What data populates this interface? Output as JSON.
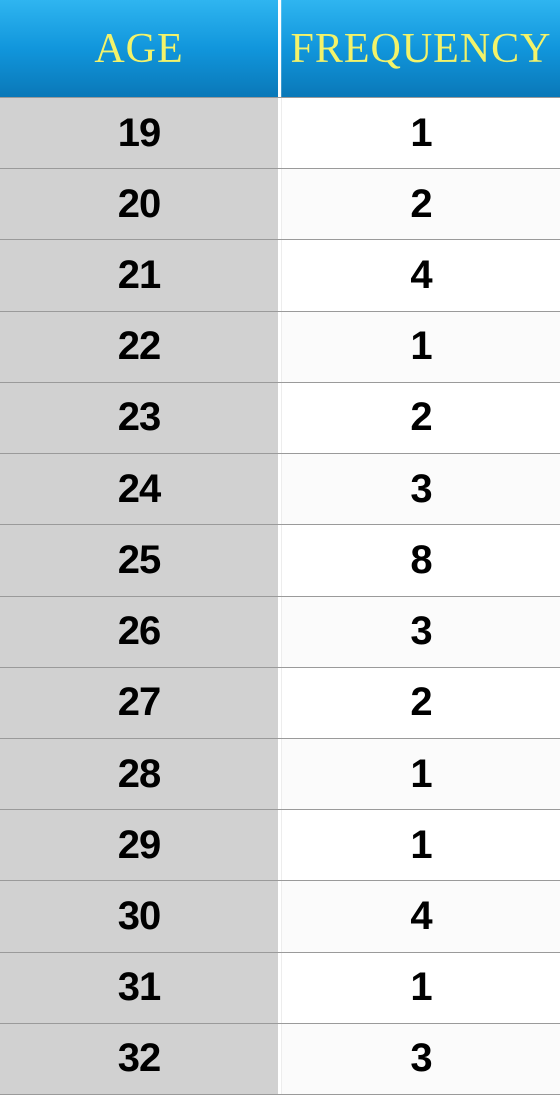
{
  "headers": {
    "age": "AGE",
    "freq": "FREQUENCY"
  },
  "rows": [
    {
      "age": "19",
      "freq": "1"
    },
    {
      "age": "20",
      "freq": "2"
    },
    {
      "age": "21",
      "freq": "4"
    },
    {
      "age": "22",
      "freq": "1"
    },
    {
      "age": "23",
      "freq": "2"
    },
    {
      "age": "24",
      "freq": "3"
    },
    {
      "age": "25",
      "freq": "8"
    },
    {
      "age": "26",
      "freq": "3"
    },
    {
      "age": "27",
      "freq": "2"
    },
    {
      "age": "28",
      "freq": "1"
    },
    {
      "age": "29",
      "freq": "1"
    },
    {
      "age": "30",
      "freq": "4"
    },
    {
      "age": "31",
      "freq": "1"
    },
    {
      "age": "32",
      "freq": "3"
    }
  ],
  "chart_data": {
    "type": "table",
    "title": "",
    "columns": [
      "AGE",
      "FREQUENCY"
    ],
    "categories": [
      19,
      20,
      21,
      22,
      23,
      24,
      25,
      26,
      27,
      28,
      29,
      30,
      31,
      32
    ],
    "values": [
      1,
      2,
      4,
      1,
      2,
      3,
      8,
      3,
      2,
      1,
      1,
      4,
      1,
      3
    ],
    "xlabel": "AGE",
    "ylabel": "FREQUENCY"
  }
}
